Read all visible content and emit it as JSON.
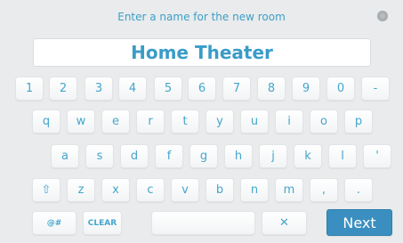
{
  "dialog": {
    "prompt": "Enter a name for the new room",
    "name_value": "Home Theater",
    "close_icon": "close-icon"
  },
  "keyboard": {
    "row1": [
      "1",
      "2",
      "3",
      "4",
      "5",
      "6",
      "7",
      "8",
      "9",
      "0",
      "-"
    ],
    "row2": [
      "q",
      "w",
      "e",
      "r",
      "t",
      "y",
      "u",
      "i",
      "o",
      "p"
    ],
    "row3": [
      "a",
      "s",
      "d",
      "f",
      "g",
      "h",
      "j",
      "k",
      "l",
      "'"
    ],
    "row4": [
      "⇧",
      "z",
      "x",
      "c",
      "v",
      "b",
      "n",
      "m",
      ",",
      "."
    ],
    "symbols_label": "@#",
    "clear_label": "CLEAR",
    "space_label": "",
    "backspace_label": "✕",
    "next_label": "Next"
  }
}
